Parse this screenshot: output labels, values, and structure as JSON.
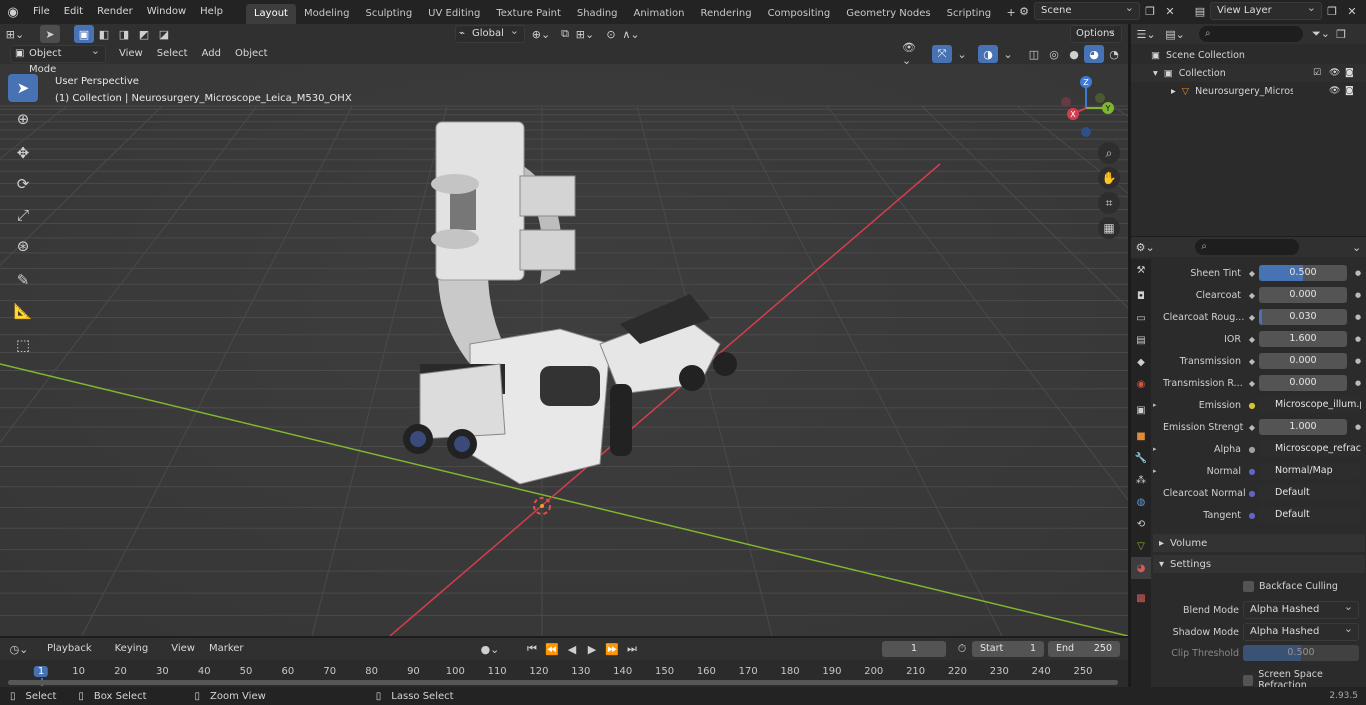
{
  "menus": [
    "File",
    "Edit",
    "Render",
    "Window",
    "Help"
  ],
  "workspaces": [
    "Layout",
    "Modeling",
    "Sculpting",
    "UV Editing",
    "Texture Paint",
    "Shading",
    "Animation",
    "Rendering",
    "Compositing",
    "Geometry Nodes",
    "Scripting"
  ],
  "active_workspace": "Layout",
  "scene": "Scene",
  "view_layer": "View Layer",
  "header": {
    "transform_orientation": "Global",
    "options": "Options"
  },
  "viewport_header": {
    "mode": "Object Mode",
    "menus": [
      "View",
      "Select",
      "Add",
      "Object"
    ]
  },
  "viewport": {
    "perspective": "User Perspective",
    "collection_info": "(1) Collection | Neurosurgery_Microscope_Leica_M530_OHX",
    "gizmo": {
      "z": "Z",
      "y": "Y",
      "x": "X"
    }
  },
  "outliner": {
    "rows": [
      "Scene Collection",
      "Collection",
      "Neurosurgery_Microscope"
    ]
  },
  "properties": {
    "rows": [
      {
        "label": "Sheen Tint",
        "value": "0.500",
        "fill": 0.5,
        "type": "slider"
      },
      {
        "label": "Clearcoat",
        "value": "0.000",
        "type": "slider"
      },
      {
        "label": "Clearcoat Roug...",
        "value": "0.030",
        "fill": 0.03,
        "type": "slider"
      },
      {
        "label": "IOR",
        "value": "1.600",
        "type": "slider"
      },
      {
        "label": "Transmission",
        "value": "0.000",
        "type": "slider"
      },
      {
        "label": "Transmission R...",
        "value": "0.000",
        "type": "slider"
      },
      {
        "label": "Emission",
        "value": "Microscope_illum.png",
        "type": "link",
        "expand": true,
        "dot": "#d4c431"
      },
      {
        "label": "Emission Strengt",
        "value": "1.000",
        "type": "slider"
      },
      {
        "label": "Alpha",
        "value": "Microscope_refract_i...",
        "type": "link",
        "expand": true,
        "dot": "#a0a0a0"
      },
      {
        "label": "Normal",
        "value": "Normal/Map",
        "type": "link",
        "expand": true,
        "dot": "#6363c7"
      },
      {
        "label": "Clearcoat Normal",
        "value": "Default",
        "type": "link",
        "dot": "#6363c7"
      },
      {
        "label": "Tangent",
        "value": "Default",
        "type": "link",
        "dot": "#6363c7"
      }
    ],
    "volume_panel": "Volume",
    "settings_panel": "Settings",
    "backface_culling": "Backface Culling",
    "blend_mode_label": "Blend Mode",
    "blend_mode": "Alpha Hashed",
    "shadow_mode_label": "Shadow Mode",
    "shadow_mode": "Alpha Hashed",
    "clip_threshold_label": "Clip Threshold",
    "clip_threshold": "0.500",
    "screen_space_refraction": "Screen Space Refraction"
  },
  "timeline": {
    "menus": [
      "Playback",
      "Keying",
      "View",
      "Marker"
    ],
    "current_frame": "1",
    "start_label": "Start",
    "start": "1",
    "end_label": "End",
    "end": "250",
    "ticks": [
      "1",
      "10",
      "20",
      "30",
      "40",
      "50",
      "60",
      "70",
      "80",
      "90",
      "100",
      "110",
      "120",
      "130",
      "140",
      "150",
      "160",
      "170",
      "180",
      "190",
      "200",
      "210",
      "220",
      "230",
      "240",
      "250"
    ]
  },
  "statusbar": {
    "select": "Select",
    "box_select": "Box Select",
    "zoom_view": "Zoom View",
    "lasso_select": "Lasso Select",
    "version": "2.93.5"
  },
  "colors": {
    "accent": "#4772b3",
    "x_axis": "#d43d4f",
    "y_axis": "#7fb82e",
    "z_axis": "#3f7bd6"
  }
}
